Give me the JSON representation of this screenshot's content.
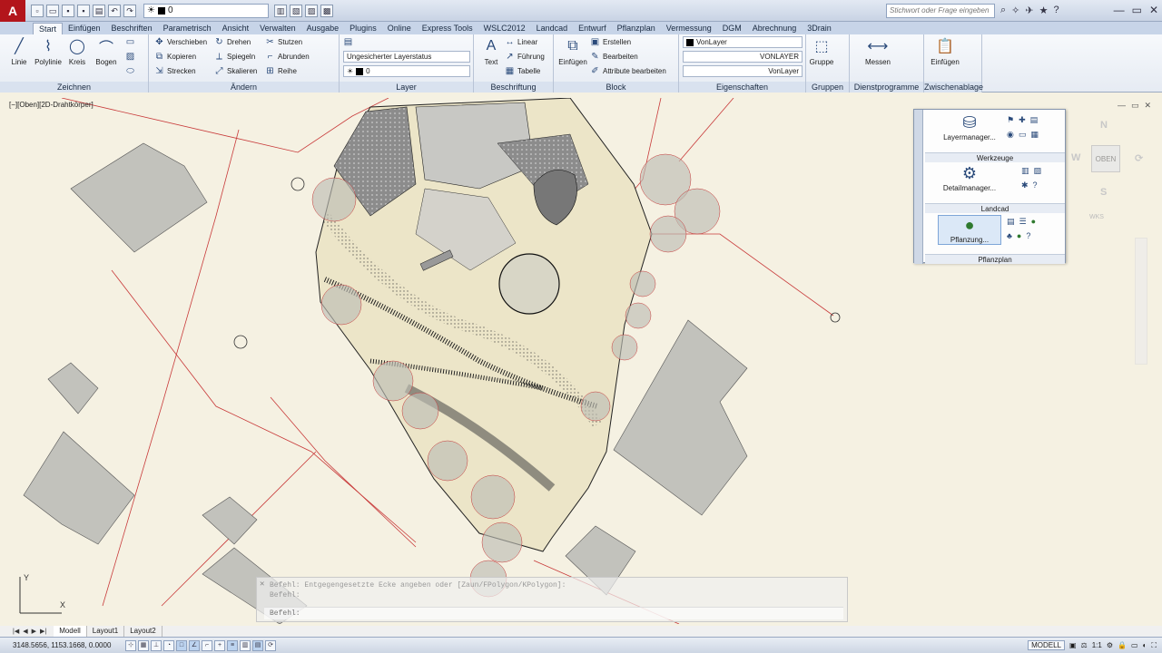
{
  "title_bar": {
    "logo": "A",
    "layer_value": "0",
    "search_placeholder": "Stichwort oder Frage eingeben"
  },
  "tabs": [
    "Start",
    "Einfügen",
    "Beschriften",
    "Parametrisch",
    "Ansicht",
    "Verwalten",
    "Ausgabe",
    "Plugins",
    "Online",
    "Express Tools",
    "WSLC2012",
    "Landcad",
    "Entwurf",
    "Pflanzplan",
    "Vermessung",
    "DGM",
    "Abrechnung",
    "3Drain"
  ],
  "ribbon": {
    "zeichnen": {
      "title": "Zeichnen",
      "linie": "Linie",
      "polylinie": "Polylinie",
      "kreis": "Kreis",
      "bogen": "Bogen"
    },
    "aendern": {
      "title": "Ändern",
      "verschieben": "Verschieben",
      "drehen": "Drehen",
      "stutzen": "Stutzen",
      "kopieren": "Kopieren",
      "spiegeln": "Spiegeln",
      "abrunden": "Abrunden",
      "strecken": "Strecken",
      "skalieren": "Skalieren",
      "reihe": "Reihe"
    },
    "layer": {
      "title": "Layer",
      "status": "Ungesicherter Layerstatus",
      "current": "0"
    },
    "beschriftung": {
      "title": "Beschriftung",
      "text": "Text",
      "linear": "Linear",
      "fuehrung": "Führung",
      "tabelle": "Tabelle"
    },
    "block": {
      "title": "Block",
      "einfuegen": "Einfügen",
      "erstellen": "Erstellen",
      "bearbeiten": "Bearbeiten",
      "attribute": "Attribute bearbeiten"
    },
    "eigenschaften": {
      "title": "Eigenschaften",
      "color": "VonLayer",
      "linetype": "VONLAYER",
      "lineweight": "VonLayer"
    },
    "gruppen": {
      "title": "Gruppen",
      "gruppe": "Gruppe"
    },
    "dienstprogramme": {
      "title": "Dienstprogramme",
      "messen": "Messen"
    },
    "zwischenablage": {
      "title": "Zwischenablage",
      "einfuegen": "Einfügen"
    }
  },
  "viewport": {
    "label": "[−][Oben][2D-Drahtkörper]"
  },
  "palette": {
    "sections": [
      {
        "tool": "Layermanager...",
        "title": "Werkzeuge"
      },
      {
        "tool": "Detailmanager...",
        "title": "Landcad"
      },
      {
        "tool": "Pflanzung...",
        "title": "Pflanzplan"
      }
    ]
  },
  "viewcube": {
    "face": "OBEN",
    "north": "N",
    "south": "S",
    "west": "W",
    "wks": "WKS"
  },
  "command": {
    "line1": "Befehl: Entgegengesetzte Ecke angeben oder [Zaun/FPolygon/KPolygon]:",
    "line2": "Befehl:",
    "prompt": "Befehl:"
  },
  "layout_tabs": [
    "Modell",
    "Layout1",
    "Layout2"
  ],
  "status": {
    "coords": "3148.5656, 1153.1668, 0.0000",
    "model": "MODELL",
    "scale": "1:1"
  }
}
